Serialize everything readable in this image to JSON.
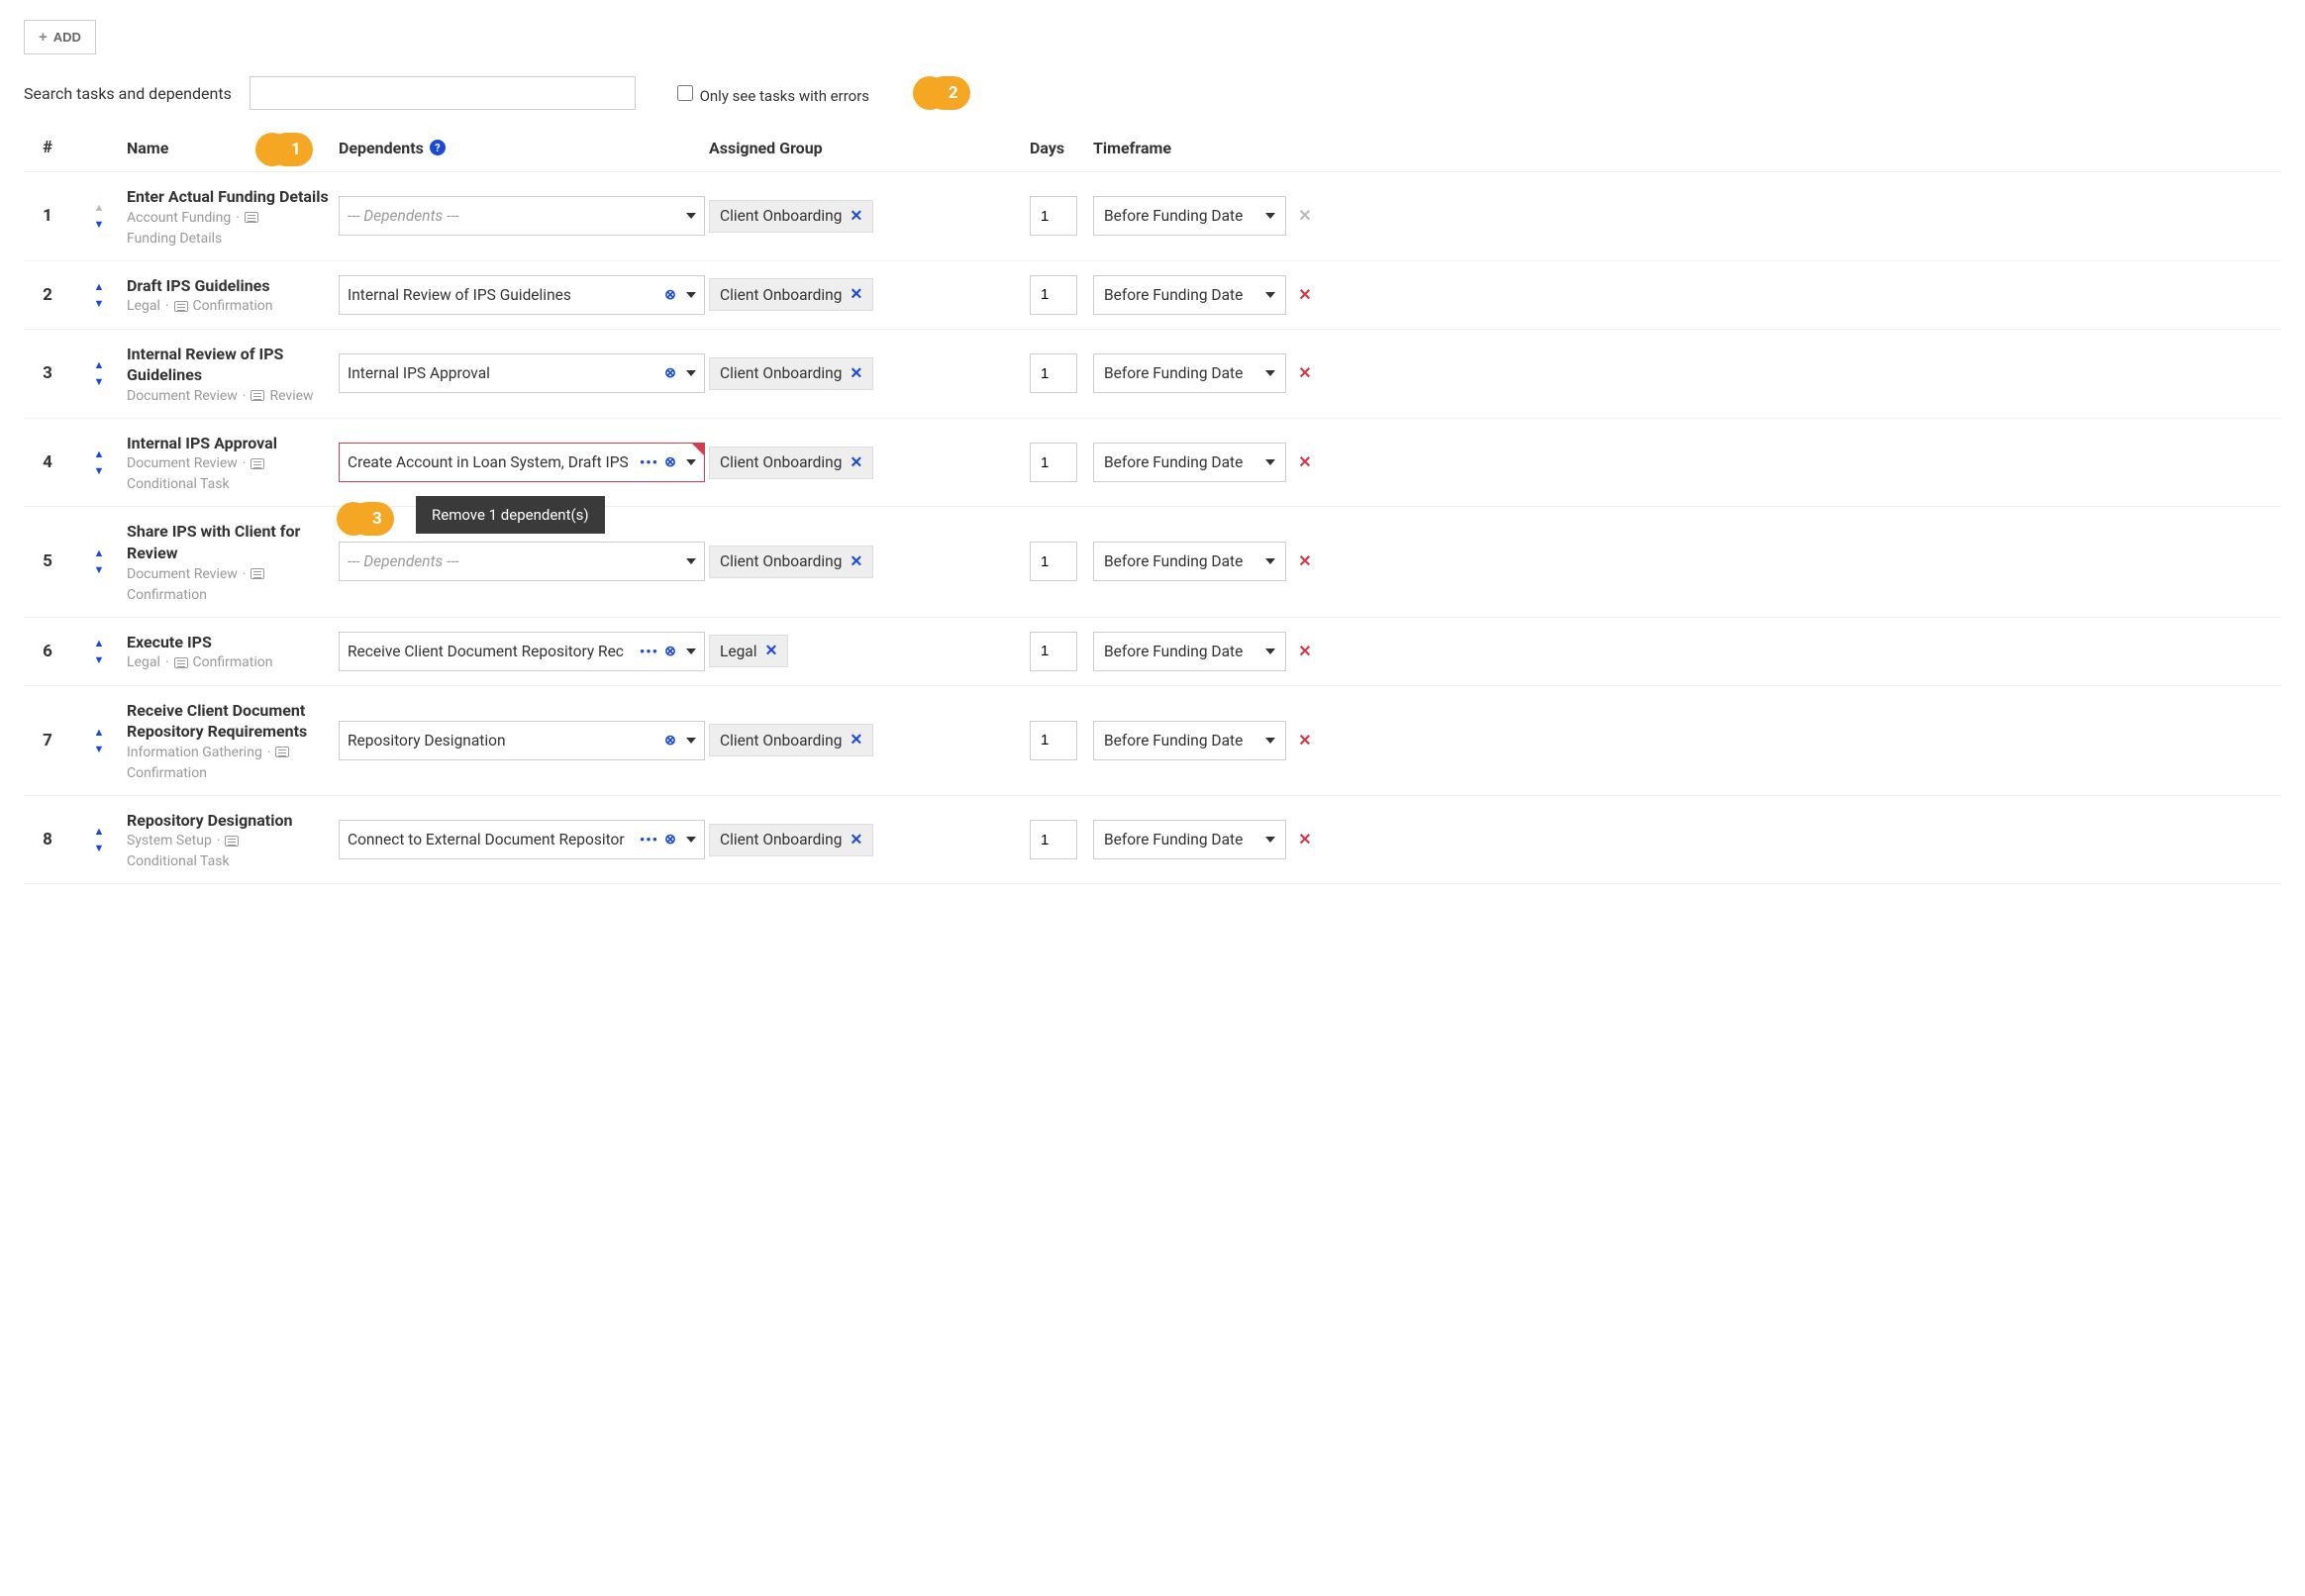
{
  "toolbar": {
    "add_label": "ADD"
  },
  "search": {
    "label": "Search tasks and dependents",
    "value": "",
    "errors_checkbox_label": "Only see tasks with errors"
  },
  "columns": {
    "num": "#",
    "name": "Name",
    "dependents": "Dependents",
    "group": "Assigned Group",
    "days": "Days",
    "timeframe": "Timeframe"
  },
  "callouts": {
    "c1": "1",
    "c2": "2",
    "c3": "3",
    "tooltip": "Remove 1 dependent(s)"
  },
  "placeholders": {
    "dependents": "--- Dependents ---"
  },
  "rows": [
    {
      "num": "1",
      "title": "Enter Actual Funding Details",
      "meta1": "Account Funding",
      "meta2": "Funding Details",
      "dependents": "",
      "has_ellipsis": false,
      "has_clear": false,
      "group": "Client Onboarding",
      "days": "1",
      "timeframe": "Before Funding Date",
      "delete_muted": true,
      "up_muted": true,
      "error": false
    },
    {
      "num": "2",
      "title": "Draft IPS Guidelines",
      "meta1": "Legal",
      "meta2": "Confirmation",
      "dependents": "Internal Review of IPS Guidelines",
      "has_ellipsis": false,
      "has_clear": true,
      "group": "Client Onboarding",
      "days": "1",
      "timeframe": "Before Funding Date",
      "delete_muted": false,
      "up_muted": false,
      "error": false
    },
    {
      "num": "3",
      "title": "Internal Review of IPS Guidelines",
      "meta1": "Document Review",
      "meta2": "Review",
      "dependents": "Internal IPS Approval",
      "has_ellipsis": false,
      "has_clear": true,
      "group": "Client Onboarding",
      "days": "1",
      "timeframe": "Before Funding Date",
      "delete_muted": false,
      "up_muted": false,
      "error": false
    },
    {
      "num": "4",
      "title": "Internal IPS Approval",
      "meta1": "Document Review",
      "meta2": "Conditional Task",
      "dependents": "Create Account in Loan System, Draft IPS",
      "has_ellipsis": true,
      "has_clear": true,
      "group": "Client Onboarding",
      "days": "1",
      "timeframe": "Before Funding Date",
      "delete_muted": false,
      "up_muted": false,
      "error": true,
      "tooltip": true
    },
    {
      "num": "5",
      "title": "Share IPS with Client for Review",
      "meta1": "Document Review",
      "meta2": "Confirmation",
      "dependents": "",
      "has_ellipsis": false,
      "has_clear": false,
      "group": "Client Onboarding",
      "days": "1",
      "timeframe": "Before Funding Date",
      "delete_muted": false,
      "up_muted": false,
      "error": false
    },
    {
      "num": "6",
      "title": "Execute IPS",
      "meta1": "Legal",
      "meta2": "Confirmation",
      "dependents": "Receive Client Document Repository Rec",
      "has_ellipsis": true,
      "has_clear": true,
      "group": "Legal",
      "days": "1",
      "timeframe": "Before Funding Date",
      "delete_muted": false,
      "up_muted": false,
      "error": false
    },
    {
      "num": "7",
      "title": "Receive Client Document Repository Requirements",
      "meta1": "Information Gathering",
      "meta2": "Confirmation",
      "dependents": "Repository Designation",
      "has_ellipsis": false,
      "has_clear": true,
      "group": "Client Onboarding",
      "days": "1",
      "timeframe": "Before Funding Date",
      "delete_muted": false,
      "up_muted": false,
      "error": false
    },
    {
      "num": "8",
      "title": "Repository Designation",
      "meta1": "System Setup",
      "meta2": "Conditional Task",
      "dependents": "Connect to External Document Repositor",
      "has_ellipsis": true,
      "has_clear": true,
      "group": "Client Onboarding",
      "days": "1",
      "timeframe": "Before Funding Date",
      "delete_muted": false,
      "up_muted": false,
      "error": false
    }
  ]
}
